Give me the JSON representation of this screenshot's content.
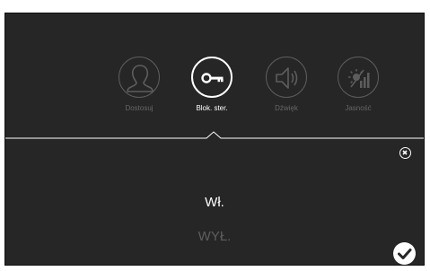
{
  "menu": {
    "items": [
      {
        "label": "Dostosuj",
        "icon": "person-icon",
        "active": false
      },
      {
        "label": "Blok. ster.",
        "icon": "key-icon",
        "active": true
      },
      {
        "label": "Dźwięk",
        "icon": "speaker-icon",
        "active": false
      },
      {
        "label": "Jasność",
        "icon": "brightness-icon",
        "active": false
      }
    ]
  },
  "options": {
    "on_label": "Wł.",
    "off_label": "WYŁ.",
    "selected": "on"
  },
  "buttons": {
    "close_icon": "close-icon",
    "confirm_icon": "checkmark-icon"
  },
  "colors": {
    "background": "#262626",
    "active": "#ffffff",
    "inactive": "#5d5d5d"
  }
}
